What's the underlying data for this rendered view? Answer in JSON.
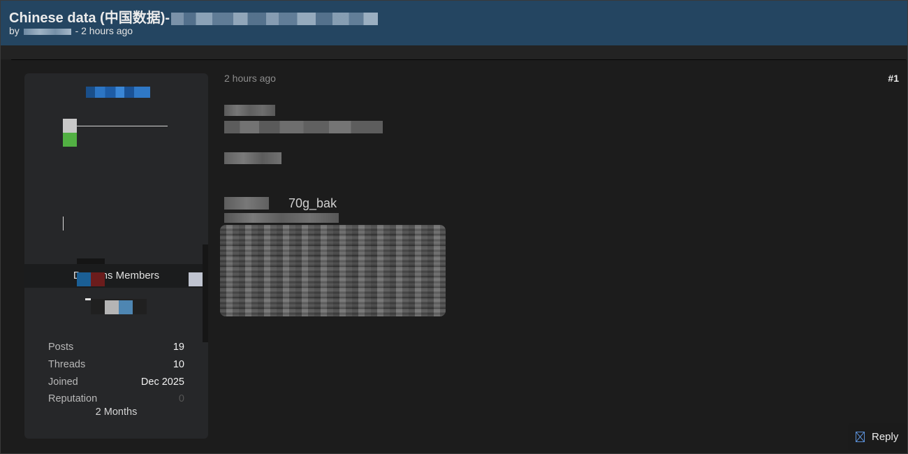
{
  "thread": {
    "title": "Chinese data (中国数据)-",
    "meta_by": "by",
    "meta_time": "- 2 hours ago"
  },
  "author": {
    "rank_label": "Dar      ums Members",
    "stats": [
      {
        "label": "Posts",
        "value": "19"
      },
      {
        "label": "Threads",
        "value": "10"
      },
      {
        "label": "Joined",
        "value": "Dec 2025"
      },
      {
        "label": "Reputation",
        "value": "0"
      }
    ],
    "member_for": "2 Months"
  },
  "post": {
    "time": "2 hours ago",
    "number": "#1",
    "visible_text": "70g_bak"
  },
  "actions": {
    "reply_label": "Reply",
    "reply_icon": "reply-icon"
  },
  "colors": {
    "header_bg": "#244561",
    "page_bg": "#1c1c1c",
    "card_bg": "#262729",
    "username_accent": "#2c75c4"
  }
}
